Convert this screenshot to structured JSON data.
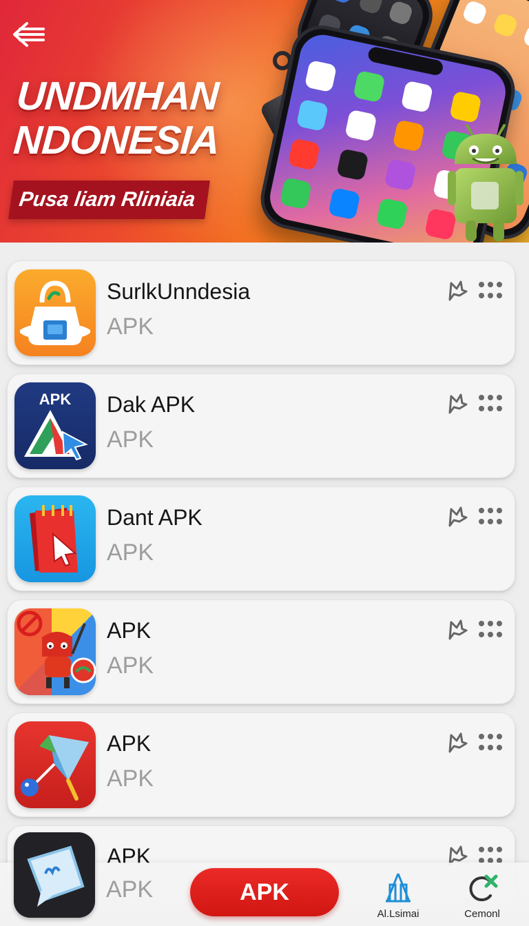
{
  "hero": {
    "title_line1": "UNDMHAN",
    "title_line2": "NDONESIA",
    "ribbon": "Pusa liam Rliniaia"
  },
  "items": [
    {
      "title": "SurlkUnndesia",
      "subtitle": "APK"
    },
    {
      "title": "Dak APK",
      "subtitle": "APK",
      "icon_text": "APK"
    },
    {
      "title": "Dant APK",
      "subtitle": "APK"
    },
    {
      "title": "APK",
      "subtitle": "APK"
    },
    {
      "title": "APK",
      "subtitle": "APK"
    },
    {
      "title": "APK",
      "subtitle": "APK"
    }
  ],
  "bottom_nav": {
    "primary_button": "APK",
    "tab1_label": "Al.Lsimai",
    "tab2_label": "Cemonl"
  },
  "colors": {
    "accent_red": "#d9201d",
    "hero_start": "#e0273a",
    "hero_end": "#f3b12c",
    "card_bg": "#f5f5f5",
    "subtitle_gray": "#9d9d9d"
  }
}
